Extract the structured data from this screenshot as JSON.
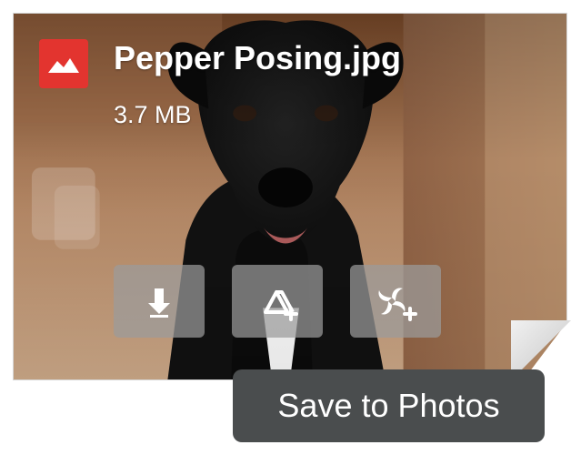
{
  "attachment": {
    "file_name": "Pepper Posing.jpg",
    "file_size": "3.7 MB",
    "file_type_icon": "image-file-icon",
    "accent_color": "#e3342f"
  },
  "actions": [
    {
      "name": "download",
      "icon": "download-icon"
    },
    {
      "name": "add-to-drive",
      "icon": "drive-add-icon"
    },
    {
      "name": "add-to-photos",
      "icon": "photos-add-icon"
    }
  ],
  "tooltip": {
    "text": "Save to Photos"
  }
}
